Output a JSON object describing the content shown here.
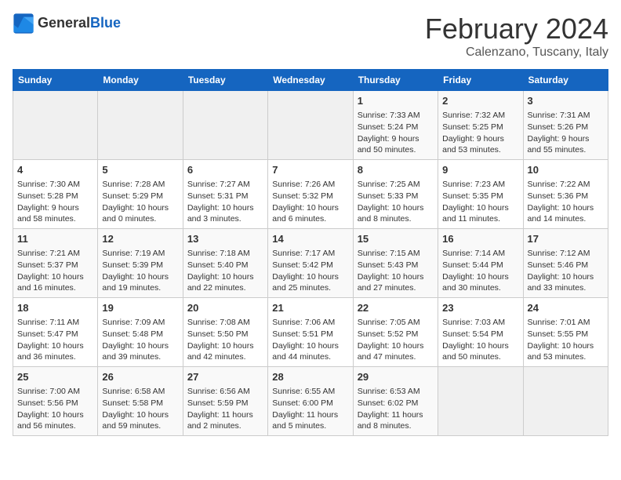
{
  "header": {
    "logo_general": "General",
    "logo_blue": "Blue",
    "month_title": "February 2024",
    "location": "Calenzano, Tuscany, Italy"
  },
  "weekdays": [
    "Sunday",
    "Monday",
    "Tuesday",
    "Wednesday",
    "Thursday",
    "Friday",
    "Saturday"
  ],
  "weeks": [
    [
      {
        "day": "",
        "info": ""
      },
      {
        "day": "",
        "info": ""
      },
      {
        "day": "",
        "info": ""
      },
      {
        "day": "",
        "info": ""
      },
      {
        "day": "1",
        "info": "Sunrise: 7:33 AM\nSunset: 5:24 PM\nDaylight: 9 hours\nand 50 minutes."
      },
      {
        "day": "2",
        "info": "Sunrise: 7:32 AM\nSunset: 5:25 PM\nDaylight: 9 hours\nand 53 minutes."
      },
      {
        "day": "3",
        "info": "Sunrise: 7:31 AM\nSunset: 5:26 PM\nDaylight: 9 hours\nand 55 minutes."
      }
    ],
    [
      {
        "day": "4",
        "info": "Sunrise: 7:30 AM\nSunset: 5:28 PM\nDaylight: 9 hours\nand 58 minutes."
      },
      {
        "day": "5",
        "info": "Sunrise: 7:28 AM\nSunset: 5:29 PM\nDaylight: 10 hours\nand 0 minutes."
      },
      {
        "day": "6",
        "info": "Sunrise: 7:27 AM\nSunset: 5:31 PM\nDaylight: 10 hours\nand 3 minutes."
      },
      {
        "day": "7",
        "info": "Sunrise: 7:26 AM\nSunset: 5:32 PM\nDaylight: 10 hours\nand 6 minutes."
      },
      {
        "day": "8",
        "info": "Sunrise: 7:25 AM\nSunset: 5:33 PM\nDaylight: 10 hours\nand 8 minutes."
      },
      {
        "day": "9",
        "info": "Sunrise: 7:23 AM\nSunset: 5:35 PM\nDaylight: 10 hours\nand 11 minutes."
      },
      {
        "day": "10",
        "info": "Sunrise: 7:22 AM\nSunset: 5:36 PM\nDaylight: 10 hours\nand 14 minutes."
      }
    ],
    [
      {
        "day": "11",
        "info": "Sunrise: 7:21 AM\nSunset: 5:37 PM\nDaylight: 10 hours\nand 16 minutes."
      },
      {
        "day": "12",
        "info": "Sunrise: 7:19 AM\nSunset: 5:39 PM\nDaylight: 10 hours\nand 19 minutes."
      },
      {
        "day": "13",
        "info": "Sunrise: 7:18 AM\nSunset: 5:40 PM\nDaylight: 10 hours\nand 22 minutes."
      },
      {
        "day": "14",
        "info": "Sunrise: 7:17 AM\nSunset: 5:42 PM\nDaylight: 10 hours\nand 25 minutes."
      },
      {
        "day": "15",
        "info": "Sunrise: 7:15 AM\nSunset: 5:43 PM\nDaylight: 10 hours\nand 27 minutes."
      },
      {
        "day": "16",
        "info": "Sunrise: 7:14 AM\nSunset: 5:44 PM\nDaylight: 10 hours\nand 30 minutes."
      },
      {
        "day": "17",
        "info": "Sunrise: 7:12 AM\nSunset: 5:46 PM\nDaylight: 10 hours\nand 33 minutes."
      }
    ],
    [
      {
        "day": "18",
        "info": "Sunrise: 7:11 AM\nSunset: 5:47 PM\nDaylight: 10 hours\nand 36 minutes."
      },
      {
        "day": "19",
        "info": "Sunrise: 7:09 AM\nSunset: 5:48 PM\nDaylight: 10 hours\nand 39 minutes."
      },
      {
        "day": "20",
        "info": "Sunrise: 7:08 AM\nSunset: 5:50 PM\nDaylight: 10 hours\nand 42 minutes."
      },
      {
        "day": "21",
        "info": "Sunrise: 7:06 AM\nSunset: 5:51 PM\nDaylight: 10 hours\nand 44 minutes."
      },
      {
        "day": "22",
        "info": "Sunrise: 7:05 AM\nSunset: 5:52 PM\nDaylight: 10 hours\nand 47 minutes."
      },
      {
        "day": "23",
        "info": "Sunrise: 7:03 AM\nSunset: 5:54 PM\nDaylight: 10 hours\nand 50 minutes."
      },
      {
        "day": "24",
        "info": "Sunrise: 7:01 AM\nSunset: 5:55 PM\nDaylight: 10 hours\nand 53 minutes."
      }
    ],
    [
      {
        "day": "25",
        "info": "Sunrise: 7:00 AM\nSunset: 5:56 PM\nDaylight: 10 hours\nand 56 minutes."
      },
      {
        "day": "26",
        "info": "Sunrise: 6:58 AM\nSunset: 5:58 PM\nDaylight: 10 hours\nand 59 minutes."
      },
      {
        "day": "27",
        "info": "Sunrise: 6:56 AM\nSunset: 5:59 PM\nDaylight: 11 hours\nand 2 minutes."
      },
      {
        "day": "28",
        "info": "Sunrise: 6:55 AM\nSunset: 6:00 PM\nDaylight: 11 hours\nand 5 minutes."
      },
      {
        "day": "29",
        "info": "Sunrise: 6:53 AM\nSunset: 6:02 PM\nDaylight: 11 hours\nand 8 minutes."
      },
      {
        "day": "",
        "info": ""
      },
      {
        "day": "",
        "info": ""
      }
    ]
  ]
}
